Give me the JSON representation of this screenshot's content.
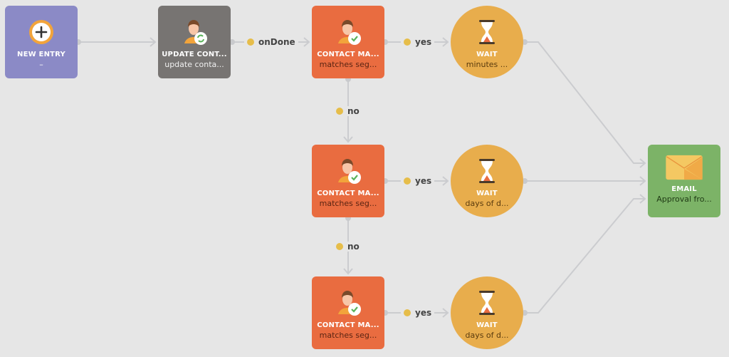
{
  "colors": {
    "background": "#e6e6e6",
    "new_entry": "#8b8ac6",
    "update_contact": "#777472",
    "contact_match": "#e96c40",
    "wait": "#e8ad4c",
    "email": "#7cb367",
    "edge": "#cbcccf",
    "label_dot": "#e6bd4a"
  },
  "nodes": [
    {
      "id": "new-entry",
      "type": "new_entry",
      "icon": "plus-circle-icon",
      "title": "NEW ENTRY",
      "subtitle": "–"
    },
    {
      "id": "update-contact",
      "type": "update_contact",
      "icon": "contact-refresh-icon",
      "title": "UPDATE CONT...",
      "subtitle": "update conta..."
    },
    {
      "id": "contact-match-1",
      "type": "contact_match",
      "icon": "contact-check-icon",
      "title": "CONTACT MA...",
      "subtitle": "matches seg..."
    },
    {
      "id": "wait-1",
      "type": "wait",
      "icon": "hourglass-icon",
      "title": "WAIT",
      "subtitle": "minutes ..."
    },
    {
      "id": "contact-match-2",
      "type": "contact_match",
      "icon": "contact-check-icon",
      "title": "CONTACT MA...",
      "subtitle": "matches seg..."
    },
    {
      "id": "wait-2",
      "type": "wait",
      "icon": "hourglass-icon",
      "title": "WAIT",
      "subtitle": "days of d..."
    },
    {
      "id": "contact-match-3",
      "type": "contact_match",
      "icon": "contact-check-icon",
      "title": "CONTACT MA...",
      "subtitle": "matches seg..."
    },
    {
      "id": "wait-3",
      "type": "wait",
      "icon": "hourglass-icon",
      "title": "WAIT",
      "subtitle": "days of d..."
    },
    {
      "id": "email",
      "type": "email",
      "icon": "envelope-icon",
      "title": "EMAIL",
      "subtitle": "Approval fro..."
    }
  ],
  "edges": [
    {
      "from": "new-entry",
      "to": "update-contact",
      "label": ""
    },
    {
      "from": "update-contact",
      "to": "contact-match-1",
      "label": "onDone"
    },
    {
      "from": "contact-match-1",
      "to": "wait-1",
      "label": "yes"
    },
    {
      "from": "contact-match-1",
      "to": "contact-match-2",
      "label": "no"
    },
    {
      "from": "contact-match-2",
      "to": "wait-2",
      "label": "yes"
    },
    {
      "from": "contact-match-2",
      "to": "contact-match-3",
      "label": "no"
    },
    {
      "from": "contact-match-3",
      "to": "wait-3",
      "label": "yes"
    },
    {
      "from": "wait-1",
      "to": "email",
      "label": ""
    },
    {
      "from": "wait-2",
      "to": "email",
      "label": ""
    },
    {
      "from": "wait-3",
      "to": "email",
      "label": ""
    }
  ]
}
